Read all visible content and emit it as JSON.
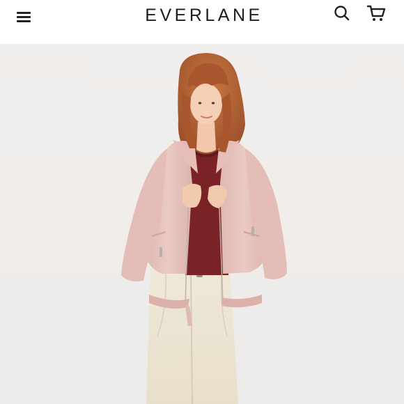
{
  "header": {
    "brand": "EVERLANE",
    "icons": [
      "menu-icon",
      "search-icon",
      "cart-icon"
    ]
  },
  "hero": {
    "background": "#efedeb",
    "jacket_color": "#e9c7c1",
    "top_color": "#7a2326",
    "jeans_color": "#ece4d2",
    "hair_color": "#b5643a"
  }
}
